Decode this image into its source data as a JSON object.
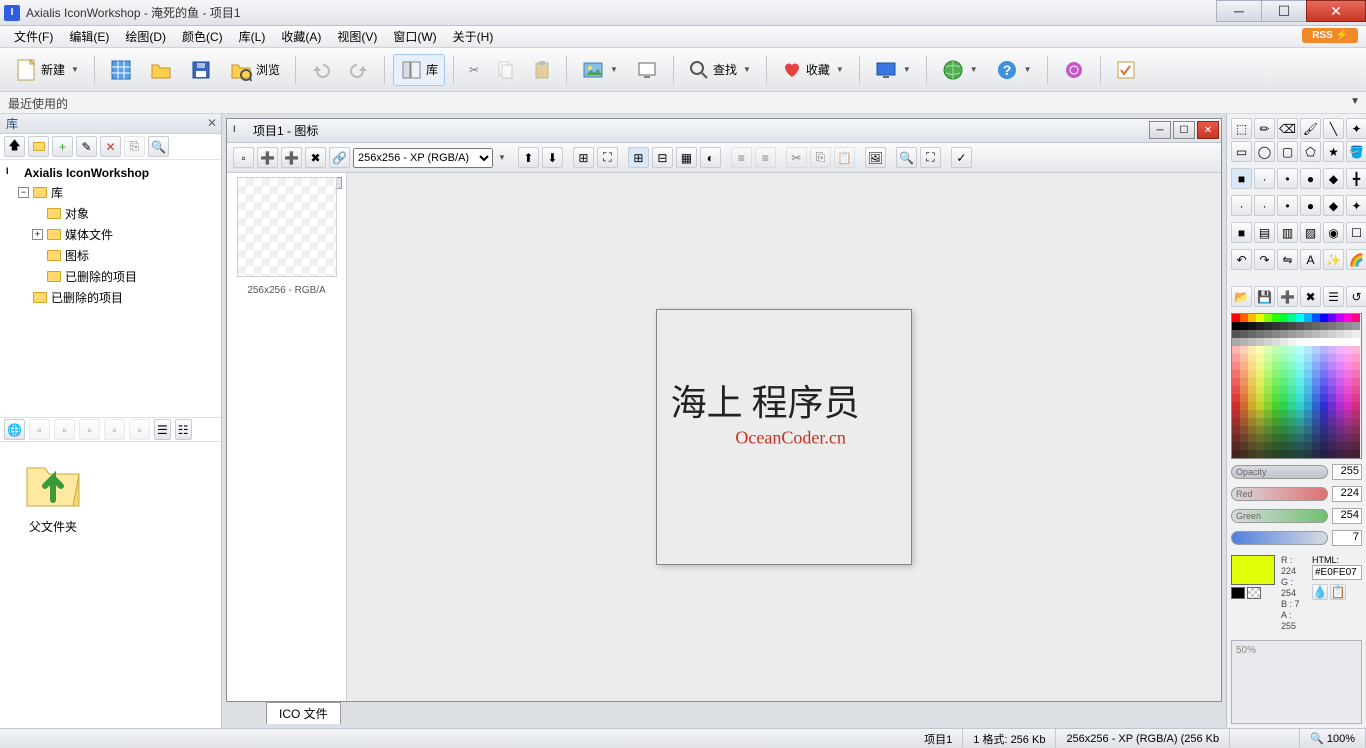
{
  "titlebar": {
    "text": "Axialis IconWorkshop - 淹死的鱼 - 项目1",
    "app_initial": "I"
  },
  "menus": {
    "file": "文件(F)",
    "edit": "编辑(E)",
    "draw": "绘图(D)",
    "color": "颜色(C)",
    "library": "库(L)",
    "favorites": "收藏(A)",
    "view": "视图(V)",
    "window": "窗口(W)",
    "about": "关于(H)",
    "rss": "RSS ⚡"
  },
  "toolbar": {
    "new": "新建",
    "browse": "浏览",
    "library": "库",
    "find": "查找",
    "favorites": "收藏"
  },
  "recent": {
    "label": "最近使用的"
  },
  "lib": {
    "title": "库",
    "root": "Axialis IconWorkshop",
    "items": [
      "库",
      "对象",
      "媒体文件",
      "图标",
      "已删除的项目",
      "已删除的项目"
    ],
    "thumb_label": "父文件夹"
  },
  "doc": {
    "title": "项目1 - 图标",
    "format": "256x256 - XP (RGB/A)",
    "fmt_label": "256x256 - RGB/A",
    "tab": "ICO 文件"
  },
  "watermark": {
    "line1": "海上 程序员",
    "line2": "OceanCoder.cn"
  },
  "color": {
    "opacity_label": "Opacity",
    "opacity": "255",
    "red_label": "Red",
    "red": "224",
    "green_label": "Green",
    "green": "254",
    "blue": "7",
    "r": "R : 224",
    "g": "G : 254",
    "b": "B : 7",
    "a": "A : 255",
    "html_label": "HTML:",
    "html": "#E0FE07",
    "swatch": "#E0FE07"
  },
  "preview": {
    "zoom": "50%"
  },
  "status": {
    "project": "项目1",
    "formats": "1 格式: 256 Kb",
    "current": "256x256 - XP (RGB/A) (256 Kb",
    "zoom": "100%"
  }
}
